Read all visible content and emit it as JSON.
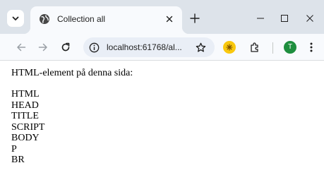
{
  "browser": {
    "tab": {
      "title": "Collection all",
      "close_icon": "close-icon",
      "favicon": "globe-icon"
    },
    "new_tab_icon": "plus-icon",
    "window_controls": [
      "minimize-icon",
      "maximize-icon",
      "close-icon"
    ],
    "toolbar": {
      "back_icon": "arrow-left-icon",
      "forward_icon": "arrow-right-icon",
      "reload_icon": "reload-icon",
      "address": "localhost:61768/al...",
      "bookmark_icon": "star-icon",
      "extension_icon": "extension-icon",
      "extensions_menu_icon": "puzzle-icon",
      "profile_initial": "T",
      "menu_icon": "kebab-menu-icon"
    },
    "colors": {
      "tabstrip": "#dde3ea",
      "toolbar": "#f8fafd",
      "omnibox": "#e9eef6",
      "avatar": "#1e8e3e",
      "extension": "#f9c80e"
    }
  },
  "page": {
    "intro": "HTML-element på denna sida:",
    "elements": [
      "HTML",
      "HEAD",
      "TITLE",
      "SCRIPT",
      "BODY",
      "P",
      "BR"
    ]
  }
}
